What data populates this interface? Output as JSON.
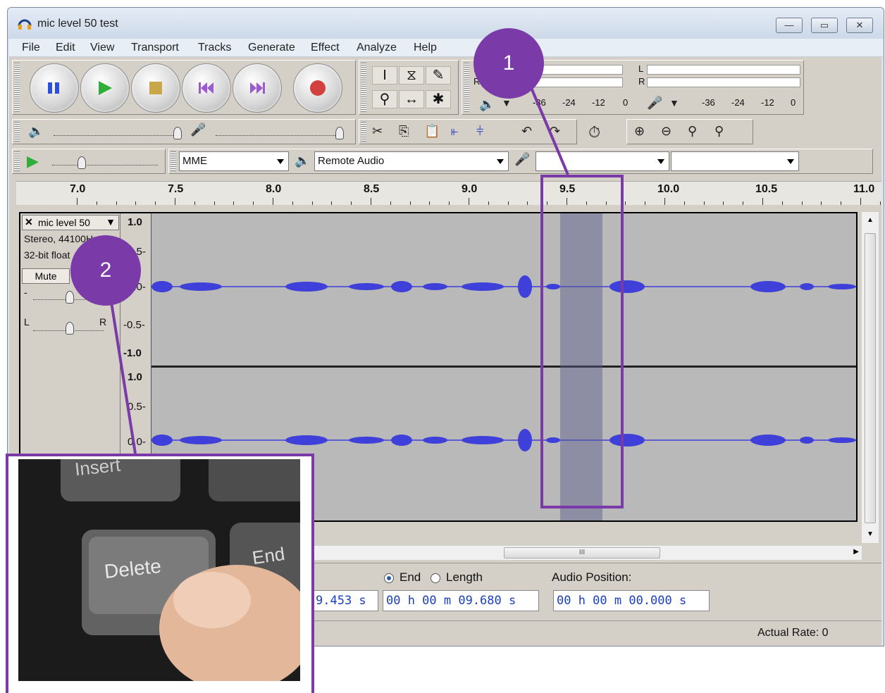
{
  "window": {
    "title": "mic level 50 test",
    "controls": [
      "—",
      "▭",
      "✕"
    ]
  },
  "menu": {
    "file": "File",
    "edit": "Edit",
    "view": "View",
    "transport": "Transport",
    "tracks": "Tracks",
    "generate": "Generate",
    "effect": "Effect",
    "analyze": "Analyze",
    "help": "Help"
  },
  "transport": {
    "pause_icon": "pause-icon",
    "play_icon": "play-icon",
    "stop_icon": "stop-icon",
    "skip_start_icon": "skip-start-icon",
    "skip_end_icon": "skip-end-icon",
    "record_icon": "record-icon"
  },
  "meters": {
    "play_l": "L",
    "play_r": "R",
    "rec_l": "L",
    "rec_r": "R",
    "scale_left": [
      "-36",
      "-24",
      "-12",
      "0"
    ],
    "scale_right": [
      "-36",
      "-24",
      "-12",
      "0"
    ]
  },
  "device": {
    "host": "MME",
    "output": "Remote Audio",
    "input": "",
    "channels": ""
  },
  "ruler": {
    "labels": [
      "7.0",
      "7.5",
      "8.0",
      "8.5",
      "9.0",
      "9.5",
      "10.0",
      "10.5",
      "11.0"
    ]
  },
  "track": {
    "name": "mic level 50",
    "format": "Stereo, 44100Hz",
    "bits": "32-bit float",
    "mute": "Mute",
    "gain_minus": "-",
    "pan_l": "L",
    "pan_r": "R",
    "scale_top": [
      "1.0",
      "0.5-",
      "0.0-",
      "-0.5-",
      "-1.0"
    ],
    "scale_bottom": [
      "1.0",
      "0.5-",
      "0.0-"
    ]
  },
  "selection": {
    "end_label": "End",
    "length_label": "Length",
    "start_value_partial": "9.453 s",
    "end_value": "00 h 00 m 09.680 s",
    "audio_position_label": "Audio Position:",
    "audio_position_value": "00 h 00 m 00.000 s"
  },
  "status": {
    "actual_rate": "Actual Rate: 0"
  },
  "annotations": {
    "step1": "1",
    "step2": "2"
  },
  "photo": {
    "key_delete": "Delete",
    "key_end": "End",
    "key_insert": "Insert"
  },
  "colors": {
    "accent": "#7a3aa8",
    "waveform": "#3f3fd9",
    "selection": "#585c8c"
  }
}
